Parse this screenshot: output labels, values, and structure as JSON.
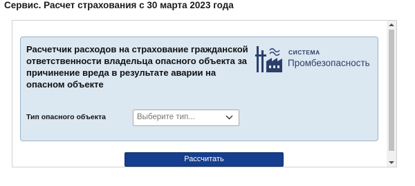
{
  "page": {
    "heading": "Сервис. Расчет страхования с 30 марта 2023 года"
  },
  "calculator": {
    "title": "Расчетчик расходов на страхование гражданской ответственности владельца опасного объекта за причинение вреда в результате аварии на опасном объекте",
    "field_label": "Тип опасного объекта",
    "select_placeholder": "Выберите тип...",
    "button_label": "Рассчитать"
  },
  "brand": {
    "top": "СИСТЕМА",
    "main": "Промбезопасность",
    "icon": "factory-icon",
    "color": "#2c3f6a"
  },
  "colors": {
    "panel_bg": "#dbe7f1",
    "panel_border": "#97b3cb",
    "button_bg": "#163e8f"
  }
}
